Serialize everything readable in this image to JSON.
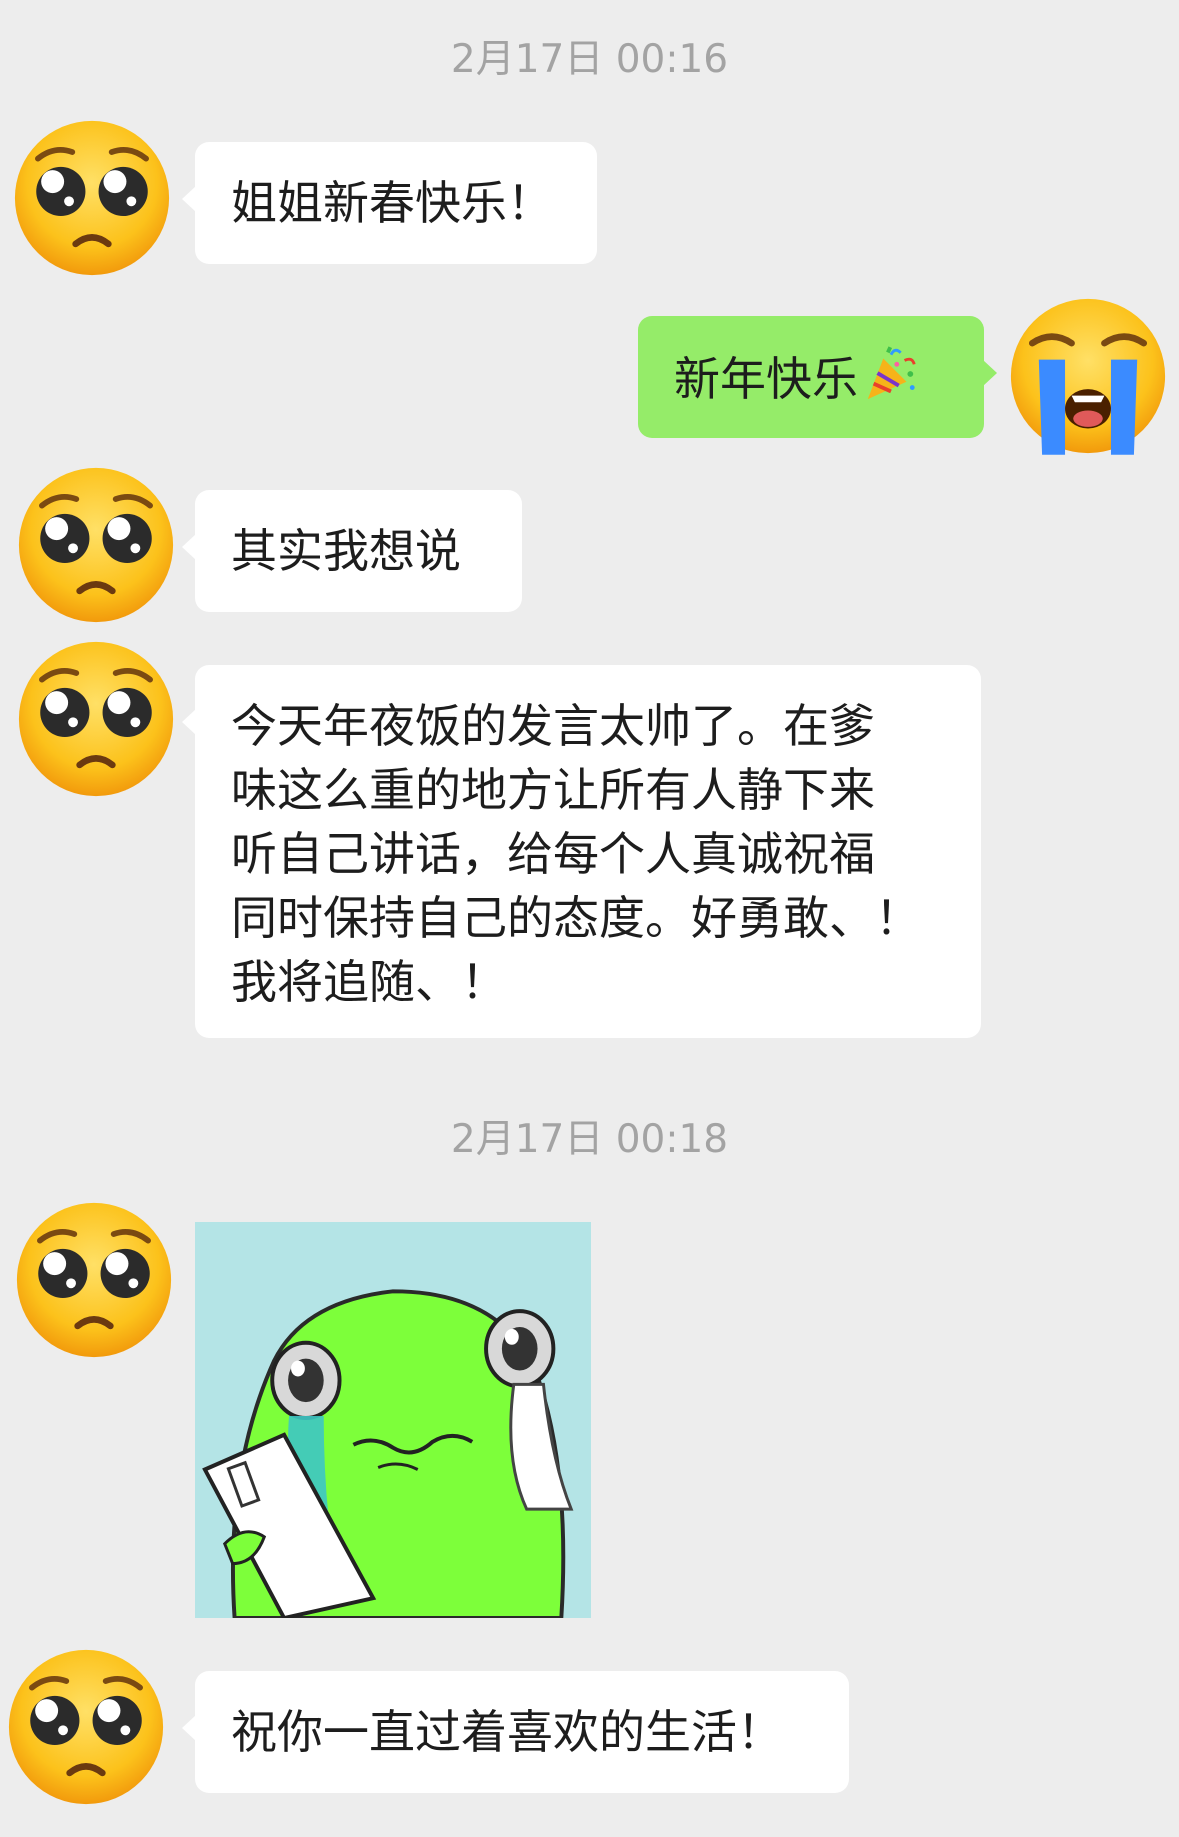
{
  "chat": {
    "timestamps": [
      "2月17日 00:16",
      "2月17日 00:18"
    ],
    "messages": [
      {
        "direction": "in",
        "type": "text",
        "lines": [
          "姐姐新春快乐！"
        ]
      },
      {
        "direction": "out",
        "type": "text",
        "lines": [
          "新年快乐"
        ],
        "trailing_emoji": "party-popper-icon"
      },
      {
        "direction": "in",
        "type": "text",
        "lines": [
          "其实我想说"
        ]
      },
      {
        "direction": "in",
        "type": "text",
        "lines": [
          "今天年夜饭的发言太帅了。在爹",
          "味这么重的地方让所有人静下来",
          "听自己讲话，给每个人真诚祝福",
          "同时保持自己的态度。好勇敢、！",
          "我将追随、！"
        ]
      },
      {
        "direction": "in",
        "type": "sticker",
        "sticker": "crying-frog-reading-paper"
      },
      {
        "direction": "in",
        "type": "text",
        "lines": [
          "祝你一直过着喜欢的生活！"
        ]
      }
    ]
  },
  "avatars": {
    "contact": "pleading-face-emoji",
    "self": "loudly-crying-face-emoji"
  },
  "colors": {
    "background": "#ededed",
    "incoming_bubble": "#ffffff",
    "outgoing_bubble": "#95ec69",
    "timestamp_text": "#a3a3a3",
    "sticker_background": "#b4e4e6",
    "frog_green": "#7dff3a"
  }
}
